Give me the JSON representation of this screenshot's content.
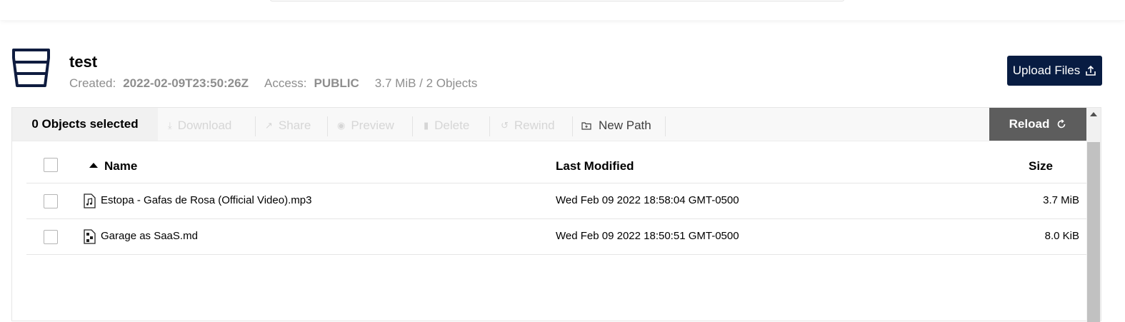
{
  "bucket": {
    "name": "test",
    "created_label": "Created:",
    "created_value": "2022-02-09T23:50:26Z",
    "access_label": "Access:",
    "access_value": "PUBLIC",
    "usage": "3.7 MiB / 2 Objects",
    "icon": "bucket-icon"
  },
  "upload_button": {
    "label": "Upload Files",
    "icon": "upload-icon"
  },
  "toolbar": {
    "selected_count": "0 Objects selected",
    "actions": [
      {
        "label": "Download",
        "icon": "download-icon",
        "enabled": false
      },
      {
        "label": "Share",
        "icon": "share-icon",
        "enabled": false
      },
      {
        "label": "Preview",
        "icon": "eye-icon",
        "enabled": false
      },
      {
        "label": "Delete",
        "icon": "trash-icon",
        "enabled": false
      },
      {
        "label": "Rewind",
        "icon": "rewind-icon",
        "enabled": false
      },
      {
        "label": "New Path",
        "icon": "new-folder-icon",
        "enabled": true
      }
    ],
    "reload_label": "Reload"
  },
  "table": {
    "columns": {
      "name": "Name",
      "last_modified": "Last Modified",
      "size": "Size"
    },
    "sort": {
      "column": "Name",
      "direction": "ascending"
    },
    "rows": [
      {
        "name": "Estopa - Gafas de Rosa (Official Video).mp3",
        "icon": "audio-file-icon",
        "last_modified": "Wed Feb 09 2022 18:58:04 GMT-0500",
        "size": "3.7 MiB"
      },
      {
        "name": "Garage as SaaS.md",
        "icon": "document-file-icon",
        "last_modified": "Wed Feb 09 2022 18:50:51 GMT-0500",
        "size": "8.0 KiB"
      }
    ]
  },
  "colors": {
    "primary_button": "#081c42",
    "reload_button": "#5d5d5d",
    "muted_text": "#8e8e8e"
  }
}
